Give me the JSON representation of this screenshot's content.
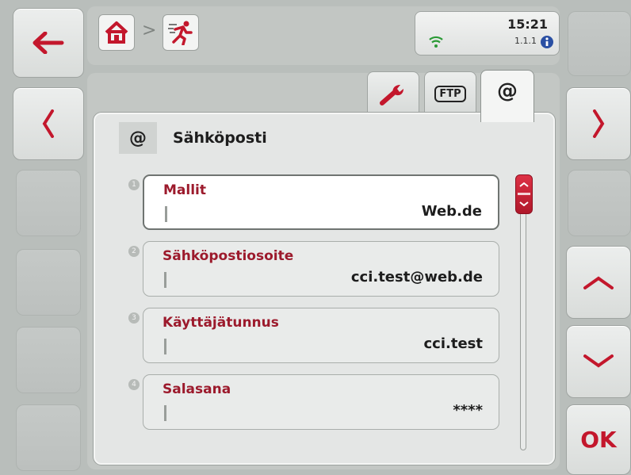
{
  "status": {
    "time": "15:21",
    "version": "1.1.1"
  },
  "tabs": [
    {
      "icon": "wrench-icon",
      "label": ""
    },
    {
      "icon": "ftp-icon",
      "label": "FTP"
    },
    {
      "icon": "at-icon",
      "label": "@"
    }
  ],
  "panel": {
    "icon_label": "@",
    "title": "Sähköposti"
  },
  "fields": [
    {
      "index": "1",
      "label": "Mallit",
      "value": "Web.de"
    },
    {
      "index": "2",
      "label": "Sähköpostiosoite",
      "value": "cci.test@web.de"
    },
    {
      "index": "3",
      "label": "Käyttäjätunnus",
      "value": "cci.test"
    },
    {
      "index": "4",
      "label": "Salasana",
      "value": "****"
    }
  ],
  "softkeys": {
    "ok_label": "OK"
  },
  "colors": {
    "accent": "#c3172c",
    "label_red": "#9c1a2c",
    "background": "#b9bebb"
  }
}
